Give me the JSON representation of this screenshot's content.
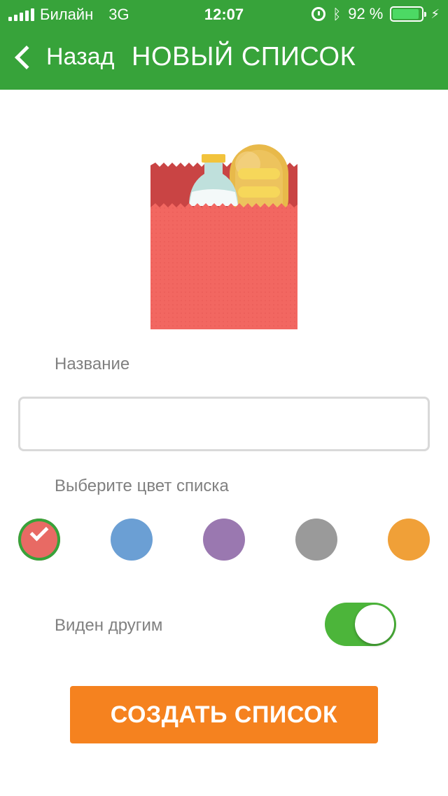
{
  "status_bar": {
    "carrier": "Билайн",
    "network": "3G",
    "time": "12:07",
    "battery_percent": "92 %",
    "battery_level": 0.92
  },
  "nav": {
    "back_label": "Назад",
    "title": "НОВЫЙ СПИСОК"
  },
  "form": {
    "name_label": "Название",
    "name_value": "",
    "name_placeholder": "",
    "color_label": "Выберите цвет списка",
    "colors": [
      {
        "name": "red",
        "hex": "#e86a64",
        "selected": true
      },
      {
        "name": "blue",
        "hex": "#6b9fd4",
        "selected": false
      },
      {
        "name": "purple",
        "hex": "#9a78b0",
        "selected": false
      },
      {
        "name": "gray",
        "hex": "#9a9a9a",
        "selected": false
      },
      {
        "name": "orange",
        "hex": "#f0a038",
        "selected": false
      }
    ],
    "visible_label": "Виден другим",
    "visible_on": true
  },
  "actions": {
    "create_label": "СОЗДАТЬ СПИСОК"
  },
  "theme": {
    "header_bg": "#37a33a",
    "accent_orange": "#f5821f",
    "toggle_on": "#4cb53a"
  },
  "icons": [
    "signal-icon",
    "alarm-icon",
    "bluetooth-icon",
    "battery-icon",
    "charging-icon",
    "chevron-left-icon",
    "check-icon",
    "grocery-bag-icon"
  ]
}
